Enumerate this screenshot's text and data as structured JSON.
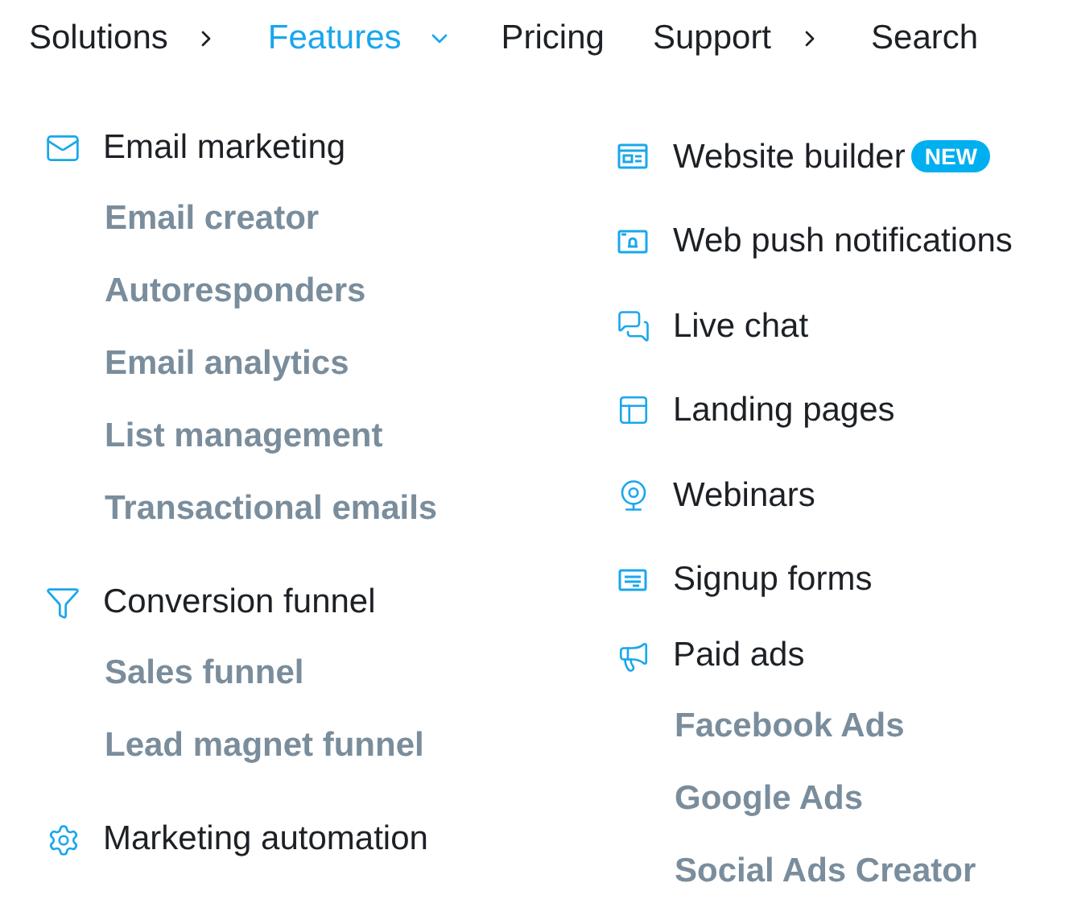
{
  "nav": [
    {
      "label": "Solutions",
      "kind": "submenu",
      "selected": false
    },
    {
      "label": "Features",
      "kind": "dropdown",
      "selected": true
    },
    {
      "label": "Pricing",
      "kind": "link",
      "selected": false
    },
    {
      "label": "Support",
      "kind": "submenu",
      "selected": false
    },
    {
      "label": "Search",
      "kind": "link",
      "selected": false
    }
  ],
  "columns": [
    {
      "groups": [
        {
          "label": "Email marketing",
          "children": [
            {
              "label": "Email creator"
            },
            {
              "label": "Autoresponders"
            },
            {
              "label": "Email analytics"
            },
            {
              "label": "List management"
            },
            {
              "label": "Transactional emails"
            }
          ]
        },
        {
          "label": "Conversion funnel",
          "children": [
            {
              "label": "Sales funnel"
            },
            {
              "label": "Lead magnet funnel"
            }
          ]
        },
        {
          "label": "Marketing automation"
        }
      ]
    },
    {
      "groups": [
        {
          "label": "Website builder",
          "badge": "NEW"
        },
        {
          "label": "Web push notifications"
        },
        {
          "label": "Live chat"
        },
        {
          "label": "Landing pages"
        },
        {
          "label": "Webinars"
        },
        {
          "label": "Signup forms"
        },
        {
          "label": "Paid ads",
          "children": [
            {
              "label": "Facebook Ads"
            },
            {
              "label": "Google Ads"
            },
            {
              "label": "Social Ads Creator"
            }
          ]
        }
      ]
    }
  ]
}
